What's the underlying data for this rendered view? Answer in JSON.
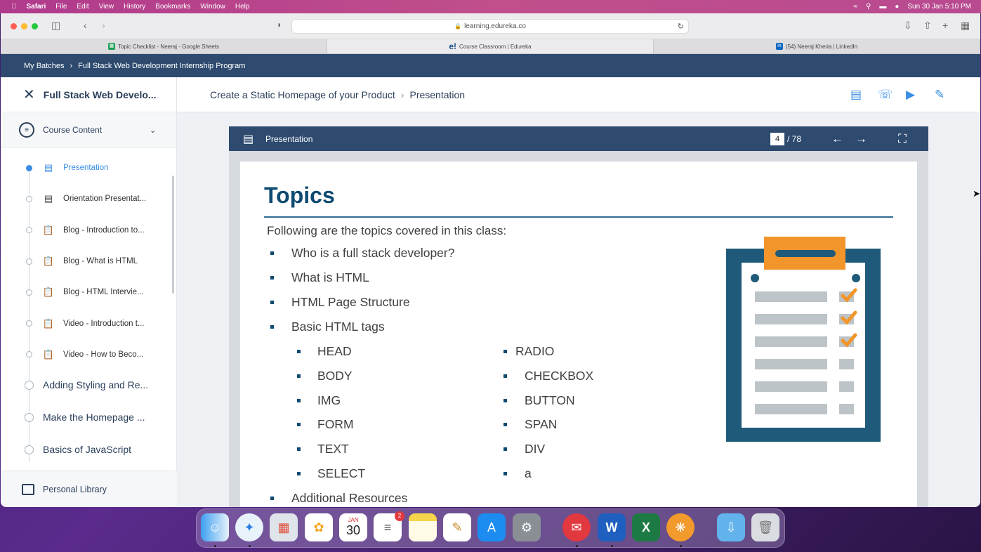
{
  "menubar": {
    "app": "Safari",
    "items": [
      "File",
      "Edit",
      "View",
      "History",
      "Bookmarks",
      "Window",
      "Help"
    ],
    "datetime": "Sun 30 Jan  5:10 PM"
  },
  "browser": {
    "url": "learning.edureka.co",
    "tabs": [
      {
        "label": "Topic Checklist - Neeraj - Google Sheets",
        "icon_color": "#1f9d55",
        "icon": "sheets-icon"
      },
      {
        "label": "Course Classroom | Edureka",
        "icon_color": "#1a4f8b",
        "icon": "edureka-icon"
      },
      {
        "label": "(54) Neeraj Kheria | LinkedIn",
        "icon_color": "#0a66c2",
        "icon": "linkedin-icon"
      }
    ]
  },
  "crumb": {
    "root": "My Batches",
    "current": "Full Stack Web Development Internship Program"
  },
  "sidebar": {
    "title": "Full Stack Web Develo...",
    "section": "Course Content",
    "items": [
      {
        "label": "Presentation",
        "icon": "presentation-icon",
        "active": true
      },
      {
        "label": "Orientation Presentat...",
        "icon": "presentation-icon",
        "active": false
      },
      {
        "label": "Blog - Introduction to...",
        "icon": "clipboard-icon",
        "active": false
      },
      {
        "label": "Blog - What is HTML",
        "icon": "clipboard-icon",
        "active": false
      },
      {
        "label": "Blog - HTML Intervie...",
        "icon": "clipboard-icon",
        "active": false
      },
      {
        "label": "Video - Introduction t...",
        "icon": "clipboard-icon",
        "active": false
      },
      {
        "label": "Video - How to Beco...",
        "icon": "clipboard-icon",
        "active": false
      }
    ],
    "modules": [
      "Adding Styling and Re...",
      "Make the Homepage ...",
      "Basics of JavaScript"
    ],
    "personal": "Personal Library"
  },
  "main": {
    "module": "Create a Static Homepage of your Product",
    "page": "Presentation"
  },
  "viewer": {
    "title": "Presentation",
    "page": "4",
    "total": "/ 78"
  },
  "slide": {
    "heading": "Topics",
    "intro": "Following are the topics covered in this class:",
    "topics": [
      "Who is a full stack developer?",
      "What is HTML",
      "HTML Page Structure",
      "Basic HTML tags"
    ],
    "tags_left": [
      "HEAD",
      "BODY",
      "IMG",
      "FORM",
      "TEXT",
      "SELECT"
    ],
    "tags_right": [
      "RADIO",
      "CHECKBOX",
      "BUTTON",
      "SPAN",
      "DIV",
      "a"
    ],
    "last": "Additional Resources"
  },
  "dock": {
    "calendar_month": "JAN",
    "calendar_day": "30",
    "reminders_badge": "2"
  },
  "colors": {
    "brand": "#2e4a6f",
    "accent": "#3a8ee6",
    "slide_title": "#0e4a72",
    "clipboard": "#1f5a7a",
    "clip_orange": "#f2952a"
  }
}
